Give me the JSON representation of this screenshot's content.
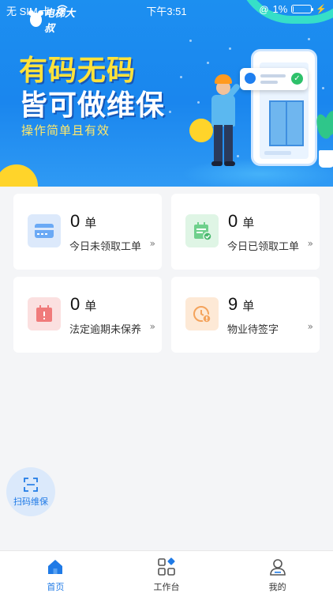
{
  "status_bar": {
    "carrier": "无 SIM 卡",
    "time": "下午3:51",
    "battery": "1%",
    "battery_level": 0.01
  },
  "banner": {
    "logo_text": "电梯大叔",
    "headline_line1": "有码无码",
    "headline_line2": "皆可做维保",
    "subtitle": "操作简单且有效"
  },
  "cards": [
    {
      "count": "0",
      "unit": "单",
      "label": "今日未领取工单",
      "chevron": "»",
      "icon": "card-icon",
      "accent": "#6aa9f5",
      "bg": "#dce9fb"
    },
    {
      "count": "0",
      "unit": "单",
      "label": "今日已领取工单",
      "chevron": "»",
      "icon": "calendar-check-icon",
      "accent": "#6fd08c",
      "bg": "#dff5e5"
    },
    {
      "count": "0",
      "unit": "单",
      "label": "法定逾期未保养",
      "chevron": "»",
      "icon": "calendar-alert-icon",
      "accent": "#f07b7b",
      "bg": "#fbe0e0"
    },
    {
      "count": "9",
      "unit": "单",
      "label": "物业待签字",
      "chevron": "»",
      "icon": "clock-alert-icon",
      "accent": "#f4a35c",
      "bg": "#fde9d6"
    }
  ],
  "scan_button": {
    "label": "扫码维保",
    "icon": "scan-icon"
  },
  "tabs": [
    {
      "label": "首页",
      "icon": "home-icon",
      "active": true
    },
    {
      "label": "工作台",
      "icon": "workbench-icon",
      "active": false
    },
    {
      "label": "我的",
      "icon": "user-icon",
      "active": false
    }
  ],
  "colors": {
    "primary": "#1f7ae6",
    "banner_blue": "#1a86ee",
    "headline_yellow": "#ffe23a",
    "page_bg": "#f4f5f7"
  }
}
